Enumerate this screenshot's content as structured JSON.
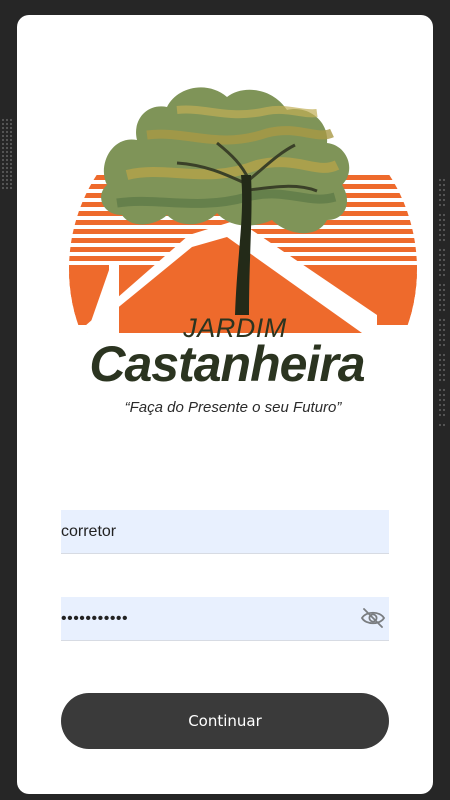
{
  "logo": {
    "line1": "JARDIM",
    "line2": "Castanheira",
    "slogan": "“Faça do Presente o seu Futuro”"
  },
  "form": {
    "username_value": "corretor",
    "password_value": "•••••••••••",
    "submit_label": "Continuar"
  },
  "icons": {
    "password_toggle": "eye-slash-icon"
  },
  "colors": {
    "background": "#262626",
    "card": "#ffffff",
    "input_fill": "#e8f0fe",
    "button": "#3a3a3a",
    "logo_orange": "#ee6a2c",
    "logo_green": "#7a8f52",
    "logo_dark": "#2b3420"
  }
}
